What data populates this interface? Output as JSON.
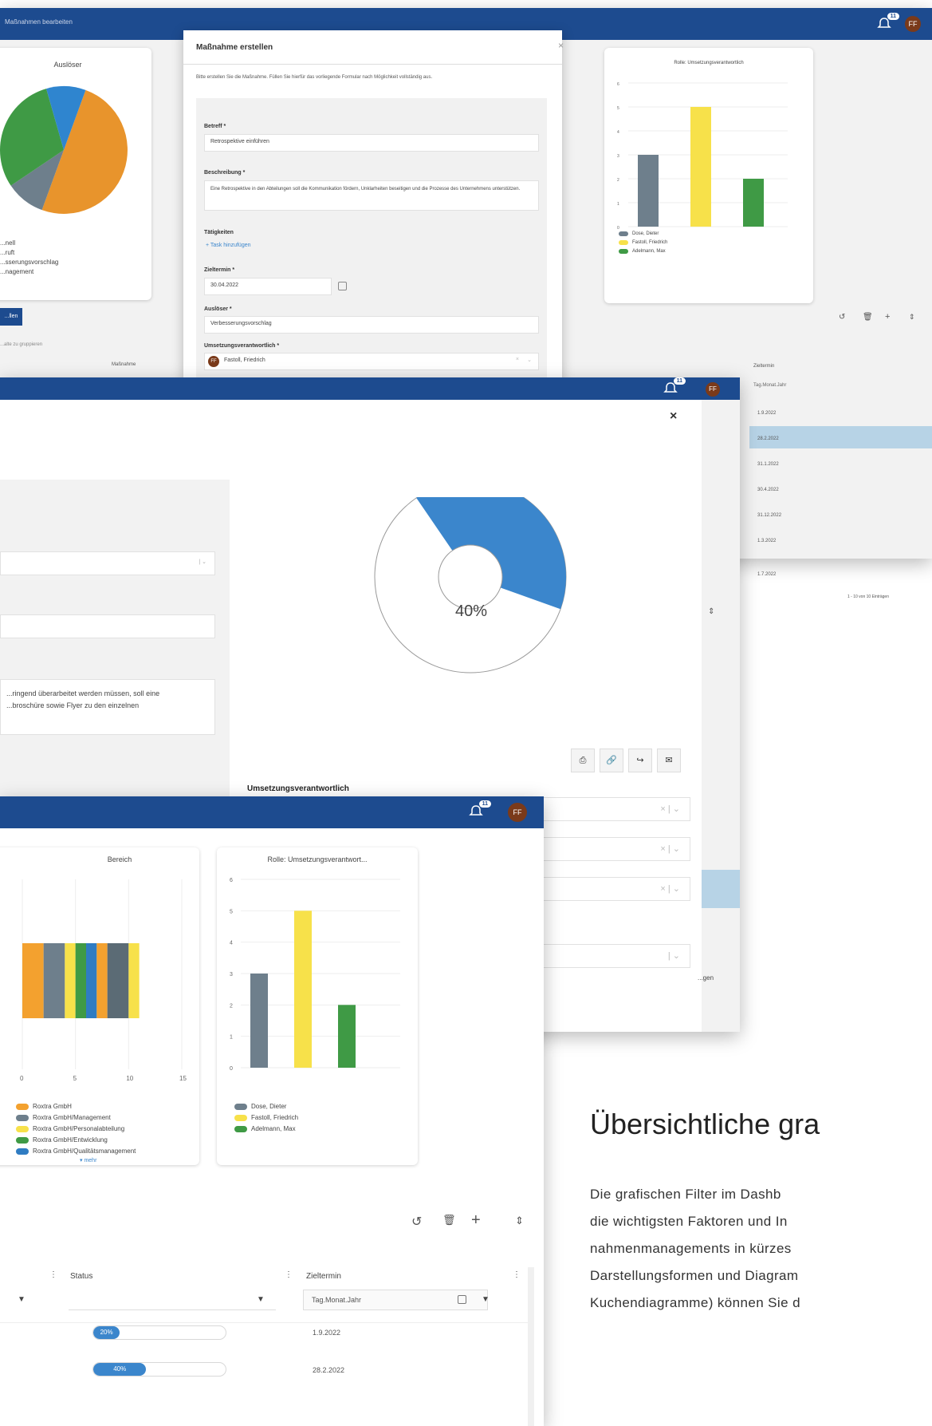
{
  "window1": {
    "topbar_title": "Maßnahmen bearbeiten",
    "bell_count": "11",
    "avatar": "FF",
    "chart_auslöser_title": "Auslöser",
    "legend_partial": [
      "...nell",
      "...ruft",
      "...sserungsvorschlag",
      "...nagement"
    ],
    "btn_partial": "...llen",
    "group_hint": "...alte zu gruppieren",
    "col_massnahme": "Maßnahme",
    "chart_rolle_title": "Rolle: Umsetzungsverantwortlich",
    "legend_rolle": [
      "Dose, Dieter",
      "Fastoll, Friedrich",
      "Adelmann, Max"
    ],
    "col_zieltermin": "Zieltermin",
    "date_placeholder": "Tag.Monat.Jahr",
    "dates": [
      "1.9.2022",
      "28.2.2022",
      "31.1.2022",
      "30.4.2022",
      "31.12.2022",
      "1.3.2022",
      "1.7.2022"
    ],
    "paging": "1 - 10 von 10 Einträgen"
  },
  "modal1": {
    "title": "Maßnahme erstellen",
    "intro": "Bitte erstellen Sie die Maßnahme. Füllen Sie hierfür das vorliegende Formular nach Möglichkeit vollständig aus.",
    "betreff_label": "Betreff *",
    "betreff_value": "Retrospektive einführen",
    "beschreibung_label": "Beschreibung *",
    "beschreibung_value": "Eine Retrospektive in den Abteilungen soll die Kommunikation fördern, Unklarheiten beseitigen und die Prozesse des Unternehmens unterstützen.",
    "taetigkeiten_label": "Tätigkeiten",
    "task_add": "+ Task hinzufügen",
    "zieltermin_label": "Zieltermin *",
    "zieltermin_value": "30.04.2022",
    "ausloeser_label": "Auslöser *",
    "ausloeser_value": "Verbesserungsvorschlag",
    "umsetzung_label": "Umsetzungsverantwortlich *",
    "umsetzung_value": "Fastoll, Friedrich",
    "umsetzung_avatar": "FF"
  },
  "window2": {
    "bell_count": "11",
    "avatar": "FF",
    "desc_text_1": "...ringend überarbeitet werden müssen, soll eine",
    "desc_text_2": "...broschüre sowie Flyer zu den einzelnen",
    "gauge_label": "40%",
    "umsetzung_label": "Umsetzungsverantwortlich",
    "partial_text": "...gen"
  },
  "window3": {
    "bell_count": "11",
    "avatar": "FF",
    "col_status": "Status",
    "col_zieltermin": "Zieltermin",
    "date_placeholder": "Tag.Monat.Jahr",
    "rows": [
      {
        "status": "20%",
        "zieltermin": "1.9.2022"
      },
      {
        "status": "40%",
        "zieltermin": "28.2.2022"
      }
    ],
    "more_link": "▾ mehr"
  },
  "chart_data": [
    {
      "type": "pie",
      "title": "Auslöser",
      "slices": [
        {
          "value": 50,
          "color": "#e8942c"
        },
        {
          "value": 10,
          "color": "#6e7f8c"
        },
        {
          "value": 30,
          "color": "#3f9a45"
        },
        {
          "value": 10,
          "color": "#2f85cf"
        }
      ]
    },
    {
      "type": "bar",
      "title": "Rolle: Umsetzungsverantwortlich",
      "categories": [
        "Dose, Dieter",
        "Fastoll, Friedrich",
        "Adelmann, Max"
      ],
      "values": [
        3,
        5,
        2
      ],
      "colors": [
        "#6e7f8c",
        "#f7e14a",
        "#3f9a45"
      ],
      "ylim": [
        0,
        6
      ]
    },
    {
      "type": "pie",
      "title": "",
      "slices": [
        {
          "value": 40,
          "color": "#3b86cc"
        },
        {
          "value": 60,
          "color": "#ffffff"
        }
      ],
      "label": "40%"
    },
    {
      "type": "bar",
      "title": "Bereich",
      "orientation": "horizontal-stacked",
      "xticks": [
        "0",
        "5",
        "10",
        "15"
      ],
      "xlim": [
        0,
        15
      ],
      "segments": [
        {
          "name": "Roxtra GmbH",
          "value": 2,
          "color": "#f3a12f"
        },
        {
          "name": "Roxtra GmbH/Management",
          "value": 2,
          "color": "#6e7f8c"
        },
        {
          "name": "Roxtra GmbH/Personalabteilung",
          "value": 1,
          "color": "#f7e14a"
        },
        {
          "name": "Roxtra GmbH/Entwicklung",
          "value": 1,
          "color": "#3f9a45"
        },
        {
          "name": "Roxtra GmbH/Qualitätsmanagement",
          "value": 1,
          "color": "#2f7cc2"
        },
        {
          "name": "",
          "value": 1,
          "color": "#f3a12f"
        },
        {
          "name": "",
          "value": 2,
          "color": "#5b6b75"
        },
        {
          "name": "",
          "value": 1,
          "color": "#f7e14a"
        }
      ],
      "legend": [
        "Roxtra GmbH",
        "Roxtra GmbH/Management",
        "Roxtra GmbH/Personalabteilung",
        "Roxtra GmbH/Entwicklung",
        "Roxtra GmbH/Qualitätsmanagement"
      ]
    },
    {
      "type": "bar",
      "title": "Rolle: Umsetzungsverantwort...",
      "categories": [
        "Dose, Dieter",
        "Fastoll, Friedrich",
        "Adelmann, Max"
      ],
      "values": [
        3,
        5,
        2
      ],
      "colors": [
        "#6e7f8c",
        "#f7e14a",
        "#3f9a45"
      ],
      "yticks": [
        "0",
        "1",
        "2",
        "3",
        "4",
        "5",
        "6"
      ],
      "ylim": [
        0,
        6
      ]
    }
  ],
  "marketing": {
    "headline": "Übersichtliche gra",
    "lines": [
      "Die grafischen Filter im Dashb",
      "die wichtigsten Faktoren und In",
      "nahmenmanagements in kürzes",
      "Darstellungsformen und Diagram",
      "Kuchendiagramme) können Sie d"
    ]
  }
}
